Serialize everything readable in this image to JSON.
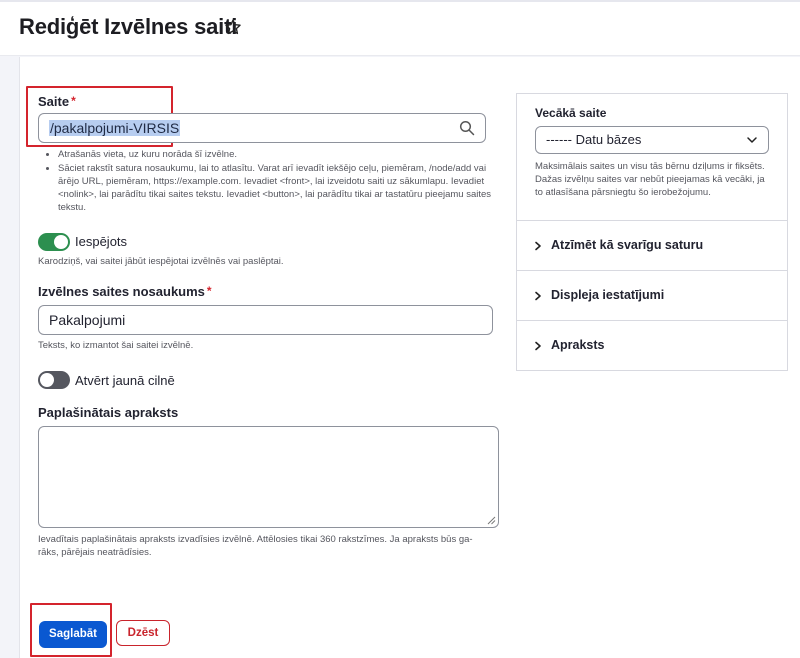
{
  "page": {
    "title": "Rediģēt Izvēlnes saiti"
  },
  "link": {
    "label": "Saite",
    "required_mark": "*",
    "value": "/pakalpojumi-VIRSIS",
    "help": [
      "Atrašanās vieta, uz kuru norāda šī izvēlne.",
      "Sāciet rakstīt satura nosaukumu, lai to atlasītu. Varat arī ievadīt iekšējo ceļu, piemēram, /node/add vai ārējo URL, piemēram, https://example.com. Ievadiet <front>, lai izveidotu saiti uz sākumlapu. Ievadiet <nolink>, lai parādītu tikai saites tekstu. Ievadiet <button>, lai parādītu tikai ar tastatūru pieejamu saites tekstu."
    ]
  },
  "enabled": {
    "label": "Iespējots",
    "on": true,
    "help": "Karodziņš, vai saitei jābūt iespējotai izvēlnēs vai paslēptai."
  },
  "title_field": {
    "label": "Izvēlnes saites nosaukums",
    "required_mark": "*",
    "value": "Pakalpojumi",
    "help": "Teksts, ko izmantot šai saitei izvēlnē."
  },
  "new_window": {
    "label": "Atvērt jaunā cilnē",
    "on": false
  },
  "description": {
    "label": "Paplašinātais apraksts",
    "value": "",
    "help": "Ievadītais paplašinātais apraksts izvadīsies izvēlnē. Attēlosies tikai 360 rakstzīmes. Ja apraksts būs ga- rāks, pārējais neatrādīsies."
  },
  "actions": {
    "save": "Saglabāt",
    "delete": "Dzēst"
  },
  "sidebar": {
    "parent_title": "Vecākā saite",
    "parent_value": "------ Datu bāzes",
    "parent_help": "Maksimālais saites un visu tās bērnu dziļums ir fiksēts. Dažas izvēlņu saites var nebūt pieejamas kā vecāki, ja to atlasīšana pārsniegtu šo ierobežojumu.",
    "accordions": [
      "Atzīmēt kā svarīgu saturu",
      "Displeja iestatījumi",
      "Apraksts"
    ]
  },
  "colors": {
    "primary": "#0a58d1",
    "danger": "#c9242c",
    "toggle_on": "#2c8f4f",
    "highlight": "#d4242d"
  }
}
